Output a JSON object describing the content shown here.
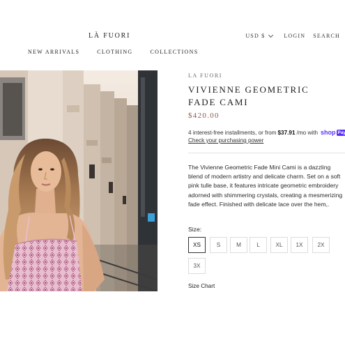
{
  "header": {
    "brand": "LÀ FUORI",
    "currency": "USD $",
    "login_label": "LOGIN",
    "search_label": "SEARCH"
  },
  "nav": {
    "items": [
      {
        "label": "NEW ARRIVALS"
      },
      {
        "label": "CLOTHING"
      },
      {
        "label": "COLLECTIONS"
      }
    ]
  },
  "product": {
    "vendor": "LA FUORI",
    "title": "VIVIENNE GEOMETRIC FADE CAMI",
    "price": "$420.00",
    "installments": {
      "prefix": "4 interest-free installments, or from",
      "amount": "$37.91",
      "suffix": "/mo with",
      "provider": "shop",
      "provider_badge": "Pay",
      "link": "Check your purchasing power"
    },
    "description": "The Vivienne Geometric Fade Mini Cami is a dazzling blend of modern artistry and delicate charm. Set on a soft pink tulle base, it features intricate geometric embroidery adorned with shimmering crystals, creating a mesmerizing fade effect. Finished with delicate lace over the hem,.",
    "size_label": "Size:",
    "sizes": [
      "XS",
      "S",
      "M",
      "L",
      "XL",
      "1X",
      "2X",
      "3X"
    ],
    "selected_size": "XS",
    "size_chart": "Size Chart"
  },
  "colors": {
    "price": "#8a5a4f",
    "shop_pay": "#5a31f4",
    "selected_border": "#333333"
  }
}
